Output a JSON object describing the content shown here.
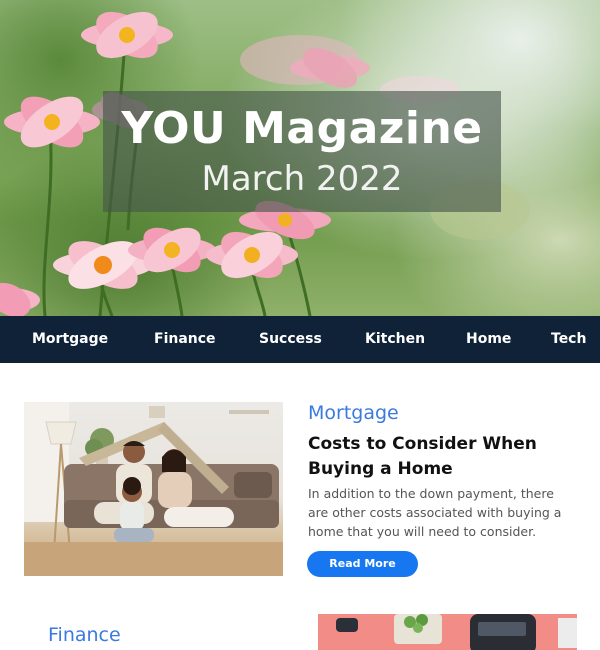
{
  "hero": {
    "title": "YOU Magazine",
    "subtitle": "March 2022"
  },
  "nav": {
    "items": [
      "Mortgage",
      "Finance",
      "Success",
      "Kitchen",
      "Home",
      "Tech"
    ]
  },
  "articles": [
    {
      "category": "Mortgage",
      "title": "Costs to Consider When Buying a Home",
      "excerpt": "In addition to the down payment, there are other costs associated with buying a home that you will need to consider.",
      "button": "Read More"
    },
    {
      "category": "Finance"
    }
  ],
  "colors": {
    "nav_bg": "#0f2238",
    "accent": "#3a7ae0",
    "button": "#1677f0"
  }
}
